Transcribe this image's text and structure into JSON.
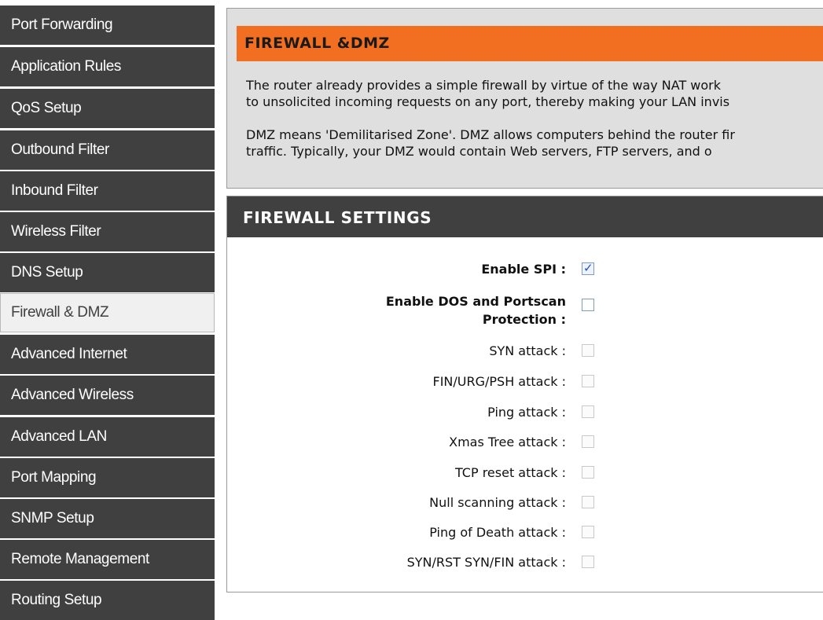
{
  "sidebar": {
    "items": [
      {
        "label": "Port Forwarding"
      },
      {
        "label": "Application Rules"
      },
      {
        "label": "QoS Setup"
      },
      {
        "label": "Outbound Filter"
      },
      {
        "label": "Inbound Filter"
      },
      {
        "label": "Wireless Filter"
      },
      {
        "label": "DNS Setup"
      },
      {
        "label": "Firewall & DMZ"
      },
      {
        "label": "Advanced Internet"
      },
      {
        "label": "Advanced Wireless"
      },
      {
        "label": "Advanced LAN"
      },
      {
        "label": "Port Mapping"
      },
      {
        "label": "SNMP Setup"
      },
      {
        "label": "Remote Management"
      },
      {
        "label": "Routing Setup"
      }
    ],
    "active": "Firewall & DMZ"
  },
  "intro": {
    "title": "FIREWALL &DMZ",
    "para1_line1": "The router already provides a simple firewall by virtue of the way NAT work",
    "para1_line2": "to unsolicited incoming requests on any port, thereby making your LAN invis",
    "para2_line1": "DMZ means 'Demilitarised Zone'. DMZ allows computers behind the router fir",
    "para2_line2": "traffic. Typically, your DMZ would contain Web servers, FTP servers, and o"
  },
  "settings": {
    "title": "FIREWALL SETTINGS",
    "enable_spi": {
      "label": "Enable SPI :",
      "checked": true
    },
    "enable_dos": {
      "label_line1": "Enable DOS and Portscan",
      "label_line2": "Protection :",
      "checked": false
    },
    "attacks": [
      {
        "label": "SYN attack :",
        "checked": false
      },
      {
        "label": "FIN/URG/PSH attack :",
        "checked": false
      },
      {
        "label": "Ping attack :",
        "checked": false
      },
      {
        "label": "Xmas Tree attack :",
        "checked": false
      },
      {
        "label": "TCP reset attack :",
        "checked": false
      },
      {
        "label": "Null scanning attack :",
        "checked": false
      },
      {
        "label": "Ping of Death attack :",
        "checked": false
      },
      {
        "label": "SYN/RST SYN/FIN attack :",
        "checked": false
      }
    ]
  },
  "colors": {
    "nav_bg": "#404040",
    "header_orange": "#f26f21",
    "panel_bg": "#dfdfdf"
  }
}
